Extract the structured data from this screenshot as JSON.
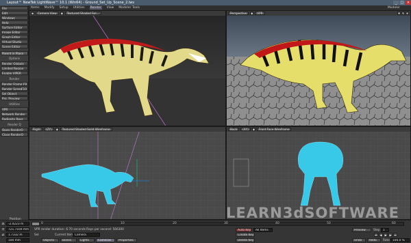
{
  "window": {
    "title": "Layout™ NewTek LightWave™ 10.1 (Win64) - Ground_Set_Up_Scene_2.lws",
    "controls": [
      "_",
      "□",
      "×"
    ]
  },
  "menubar": {
    "items": [
      "Items",
      "Modify",
      "Setup",
      "Utilities",
      "Render",
      "View",
      "Modeler Tools"
    ],
    "modeler_label": "Modeler"
  },
  "sidebar": {
    "buttons_top": [
      "File",
      "Edit",
      "Windows",
      "Help",
      "Surface Editor",
      "Image Editor",
      "Graph Editor",
      "Virtual Studio",
      "Scene Editor"
    ],
    "parent_in_place": "Parent in Place",
    "options_label": "Options",
    "options": [
      "Render Globals",
      "Limited Region",
      "Enable VIPER"
    ],
    "render_label": "Render",
    "render": [
      "Render Frame",
      "Render Scene",
      "Sel Object",
      "Pre. Preview"
    ],
    "utilities_label": "Utilities",
    "utilities": [
      "VPR",
      "Network Render",
      "Radiosity Rays"
    ],
    "render_q_label": "Render Q",
    "render_q": [
      "Open RenderQ",
      "Close RenderQ"
    ],
    "shortcuts": [
      "F9",
      "F10"
    ]
  },
  "viewports": {
    "top_left": {
      "view": "Camera View",
      "mode": "Textured Shaded Sol..."
    },
    "top_right": {
      "view": "Perspective",
      "mode": "VPR"
    },
    "bottom_left": {
      "view": "Right",
      "axis": "(ZY)",
      "mode": "Textured Shaded Solid Wireframe"
    },
    "bottom_right": {
      "view": "Back",
      "axis": "(XY)",
      "mode": "Front Face Wireframe"
    }
  },
  "timeline": {
    "position_label": "Position",
    "x_value": "-2.4223 m",
    "y_value": "721.7169 mm",
    "z_value": "1.7332 m",
    "ticks": [
      "0",
      "10",
      "20",
      "30",
      "40",
      "50",
      "60"
    ],
    "vpr_status": "VPR render duration: 6.70 seconds  Rays per second: 566300",
    "grid_value": "100 mm",
    "current_item_label": "Current Item",
    "current_item": "Camera",
    "sel_label": "Sel",
    "tabs": [
      "Objects",
      "Bones",
      "Lights",
      "Cameras",
      "Properties"
    ],
    "auto_key": "Auto Key",
    "all_key": "All Items",
    "create_key": "Create Key",
    "delete_key": "Delete Key",
    "preview": "Preview",
    "step_label": "Step",
    "step_value": "1",
    "undo": "Undo",
    "redo": "Redo",
    "rate_label": "Rate",
    "rate_value": "100.0 %"
  },
  "watermark": "LEARN3dSOFTWARE"
}
